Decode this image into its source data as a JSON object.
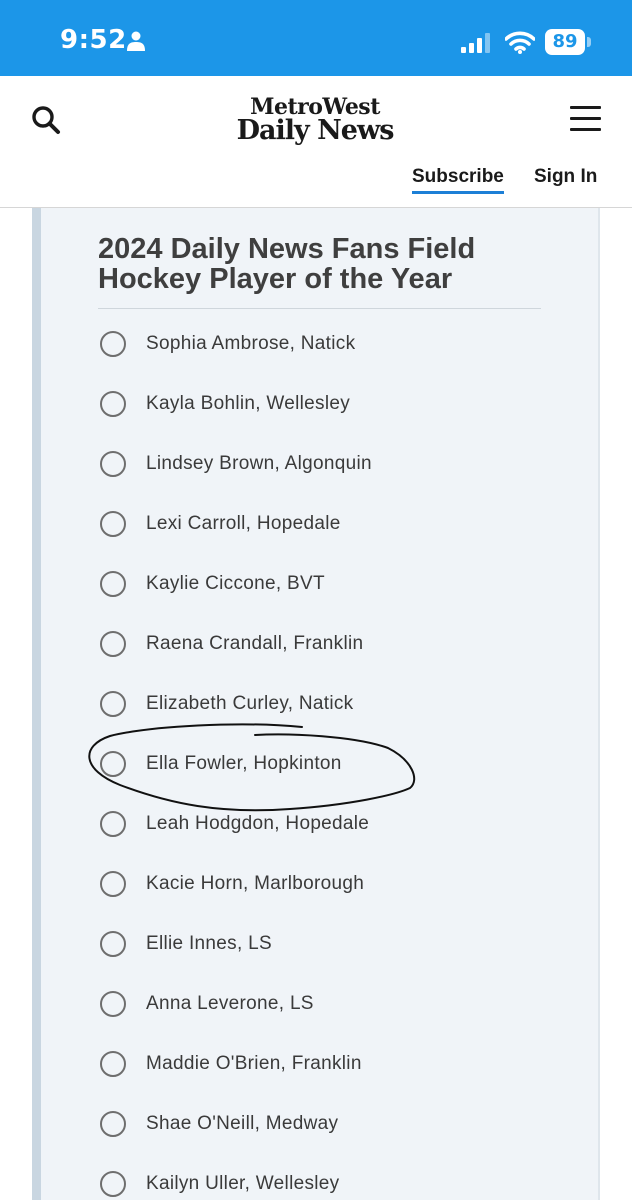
{
  "status_bar": {
    "time": "9:52",
    "battery": "89",
    "icons": [
      "person-icon",
      "signal-icon",
      "wifi-icon",
      "battery-icon"
    ]
  },
  "header": {
    "logo_top": "MetroWest",
    "logo_bottom": "Daily News",
    "subscribe": "Subscribe",
    "sign_in": "Sign In",
    "icons": [
      "search-icon",
      "menu-icon"
    ]
  },
  "poll": {
    "title": "2024 Daily News Fans Field Hockey Player of the Year",
    "options": [
      "Sophia Ambrose, Natick",
      "Kayla Bohlin, Wellesley",
      "Lindsey Brown, Algonquin",
      "Lexi Carroll, Hopedale",
      "Kaylie Ciccone, BVT",
      "Raena Crandall, Franklin",
      "Elizabeth Curley, Natick",
      "Ella Fowler, Hopkinton",
      "Leah Hodgdon, Hopedale",
      "Kacie Horn, Marlborough",
      "Ellie Innes, LS",
      "Anna Leverone, LS",
      "Maddie O'Brien, Franklin",
      "Shae O'Neill, Medway",
      "Kailyn Uller, Wellesley"
    ]
  },
  "colors": {
    "status_bar": "#1c96e8",
    "subscribe_underline": "#1c7fd6",
    "poll_background": "#f0f4f8"
  }
}
